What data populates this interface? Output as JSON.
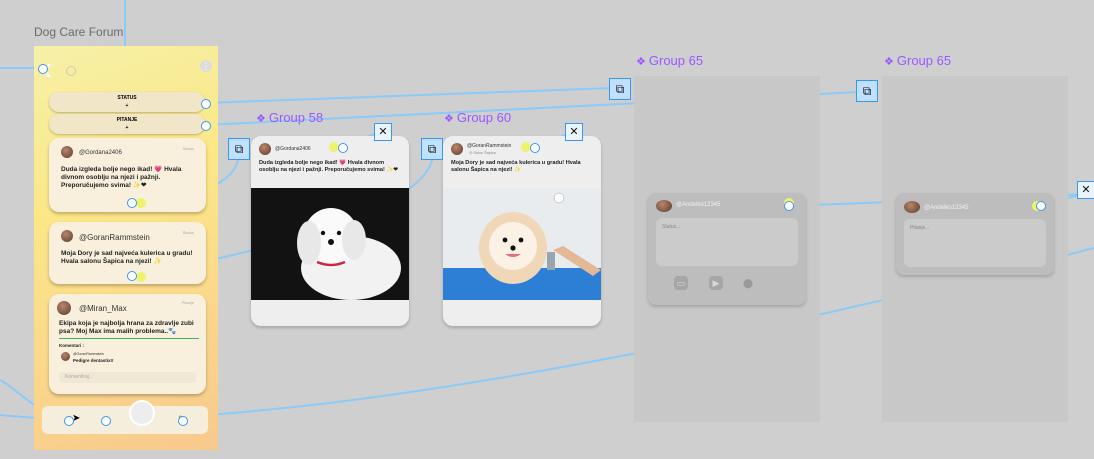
{
  "canvas": {
    "frame_title": "Dog Care Forum",
    "groups": [
      "Group 58",
      "Group 60",
      "Group 65",
      "Group 65"
    ]
  },
  "feed": {
    "buttons": [
      {
        "label": "STATUS",
        "sub": "+"
      },
      {
        "label": "PITANJE",
        "sub": "+"
      }
    ],
    "posts": [
      {
        "user": "@Gordana2406",
        "tag": "Status",
        "text": "Duda izgleda bolje nego ikad! 💗 Hvala divnom osoblju na njezi i pažnji. Preporučujemo svima! ✨❤"
      },
      {
        "user": "@GoranRammstein",
        "tag": "Status",
        "text": "Moja Dory je sad najveća kulerica u gradu! Hvala salonu Šapica na njezi! ✨"
      },
      {
        "user": "@Miran_Max",
        "tag": "Pitanje",
        "text": "Ekipa koja je najbolja hrana za zdravlje zubi psa? Moj Max ima malih problema..🐾"
      }
    ],
    "comment": {
      "label": "Komentari :",
      "user": "@GoranRammstein",
      "text": "Pedigre dentastix!!",
      "placeholder": "Komentiraj..."
    }
  },
  "detail_posts": [
    {
      "user": "@Gordana2406",
      "text": "Duda izgleda bolje nego ikad! 💗 Hvala divnom osoblju na njezi i pažnji. Preporučujemo svima! ✨❤"
    },
    {
      "user": "@GoranRammstein",
      "meta": "◎ Salon Šapica",
      "text": "Moja Dory je sad najveća kulerica u gradu! Hvala salonu Šapica na njezi! ✨"
    }
  ],
  "compose": {
    "status": {
      "user": "@Andelko12345",
      "placeholder": "Status..."
    },
    "question": {
      "user": "@Andelko12345",
      "placeholder": "Pitanje..."
    }
  },
  "icons": [
    "back-icon",
    "search-icon",
    "more-icon",
    "copy-icon",
    "close-icon",
    "image-icon",
    "play-icon",
    "location-icon",
    "home-icon",
    "paw-icon"
  ],
  "colors": {
    "group_label": "#9a58ff",
    "connector": "#8ccaf8",
    "app_gradient_top": "#f6f0a8",
    "app_gradient_bottom": "#f7c98d"
  }
}
